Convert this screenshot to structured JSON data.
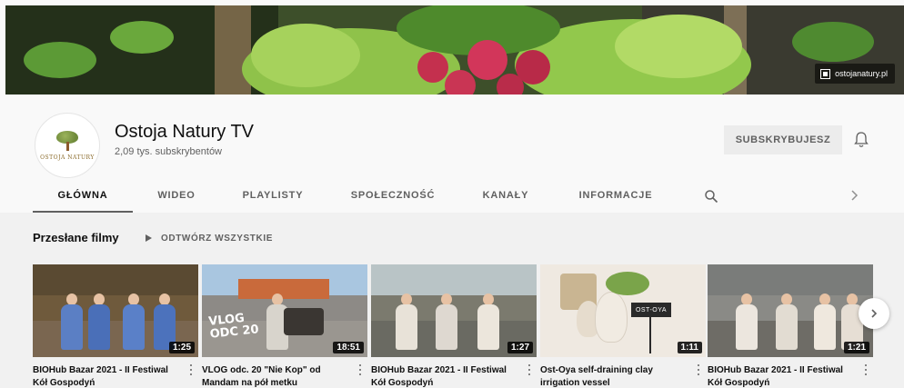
{
  "banner": {
    "link_text": "ostojanatury.pl"
  },
  "channel": {
    "avatar_brand": "OSTOJA NATURY",
    "name": "Ostoja Natury TV",
    "subscribers": "2,09 tys. subskrybentów",
    "subscribe_label": "SUBSKRYBUJESZ"
  },
  "tabs": [
    {
      "label": "GŁÓWNA",
      "active": true
    },
    {
      "label": "WIDEO"
    },
    {
      "label": "PLAYLISTY"
    },
    {
      "label": "SPOŁECZNOŚĆ"
    },
    {
      "label": "KANAŁY"
    },
    {
      "label": "INFORMACJE"
    }
  ],
  "shelf": {
    "title": "Przesłane filmy",
    "play_all": "ODTWÓRZ WSZYSTKIE"
  },
  "videos": [
    {
      "title": "BIOHub Bazar 2021 - II Festiwal Kół Gospodyń",
      "duration": "1:25"
    },
    {
      "title": "VLOG odc. 20 \"Nie Kop\" od Mandam na pół metku",
      "duration": "18:51",
      "overlay": "VLOG\nODC 20"
    },
    {
      "title": "BIOHub Bazar 2021 - II Festiwal Kół Gospodyń",
      "duration": "1:27"
    },
    {
      "title": "Ost-Oya self-draining clay irrigation vessel",
      "duration": "1:11",
      "sign": "OST-OYA"
    },
    {
      "title": "BIOHub Bazar 2021 - II Festiwal Kół Gospodyń",
      "duration": "1:21"
    }
  ],
  "colors": {
    "page_bg": "#f9f9f9",
    "shelf_bg": "#f1f1f1",
    "text_primary": "#0f0f0f",
    "text_secondary": "#606060",
    "subscribe_bg": "#ececec"
  },
  "icons": {
    "bell": "bell-icon",
    "search": "search-icon",
    "tab_next": "chevron-right-icon",
    "carousel_next": "chevron-right-icon",
    "play": "play-icon",
    "video_menu": "more-vert-icon"
  }
}
